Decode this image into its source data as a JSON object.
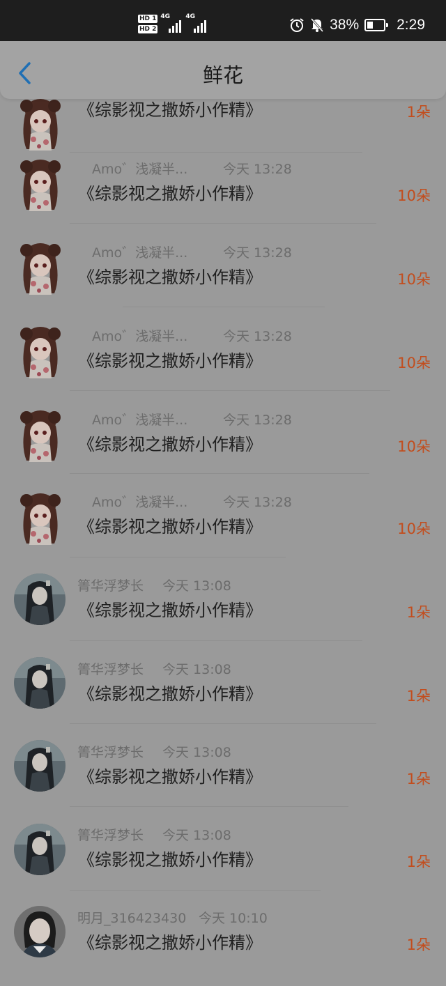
{
  "status_bar": {
    "sim1_label": "HD 1",
    "sim2_label": "HD 2",
    "network_label_1": "4G",
    "network_label_2": "4G",
    "alarm_icon": "alarm-clock-icon",
    "mute_icon": "bell-off-icon",
    "battery_percent": "38%",
    "battery_level": 0.38,
    "time": "2:29"
  },
  "header": {
    "back_icon": "chevron-left-icon",
    "title": "鲜花"
  },
  "colors": {
    "accent_blue": "#1f6fb4",
    "amount_orange": "#c24d1d",
    "overlay_gray": "#9a9a9a"
  },
  "records": [
    {
      "avatar": "anime-girl-avatar",
      "username": "",
      "time": "",
      "book": "《综影视之撒娇小作精》",
      "amount": "1朵"
    },
    {
      "avatar": "anime-girl-avatar",
      "username": "Amo゛浅凝半...",
      "time": "今天 13:28",
      "book": "《综影视之撒娇小作精》",
      "amount": "10朵"
    },
    {
      "avatar": "anime-girl-avatar",
      "username": "Amo゛浅凝半...",
      "time": "今天 13:28",
      "book": "《综影视之撒娇小作精》",
      "amount": "10朵"
    },
    {
      "avatar": "anime-girl-avatar",
      "username": "Amo゛浅凝半...",
      "time": "今天 13:28",
      "book": "《综影视之撒娇小作精》",
      "amount": "10朵"
    },
    {
      "avatar": "anime-girl-avatar",
      "username": "Amo゛浅凝半...",
      "time": "今天 13:28",
      "book": "《综影视之撒娇小作精》",
      "amount": "10朵"
    },
    {
      "avatar": "anime-girl-avatar",
      "username": "Amo゛浅凝半...",
      "time": "今天 13:28",
      "book": "《综影视之撒娇小作精》",
      "amount": "10朵"
    },
    {
      "avatar": "photo-avatar",
      "username": "箐华浮梦长",
      "time": "今天 13:08",
      "book": "《综影视之撒娇小作精》",
      "amount": "1朵"
    },
    {
      "avatar": "photo-avatar",
      "username": "箐华浮梦长",
      "time": "今天 13:08",
      "book": "《综影视之撒娇小作精》",
      "amount": "1朵"
    },
    {
      "avatar": "photo-avatar",
      "username": "箐华浮梦长",
      "time": "今天 13:08",
      "book": "《综影视之撒娇小作精》",
      "amount": "1朵"
    },
    {
      "avatar": "photo-avatar",
      "username": "箐华浮梦长",
      "time": "今天 13:08",
      "book": "《综影视之撒娇小作精》",
      "amount": "1朵"
    },
    {
      "avatar": "photo-avatar",
      "username": "明月_316423430",
      "time": "今天 10:10",
      "book": "《综影视之撒娇小作精》",
      "amount": "1朵"
    }
  ]
}
